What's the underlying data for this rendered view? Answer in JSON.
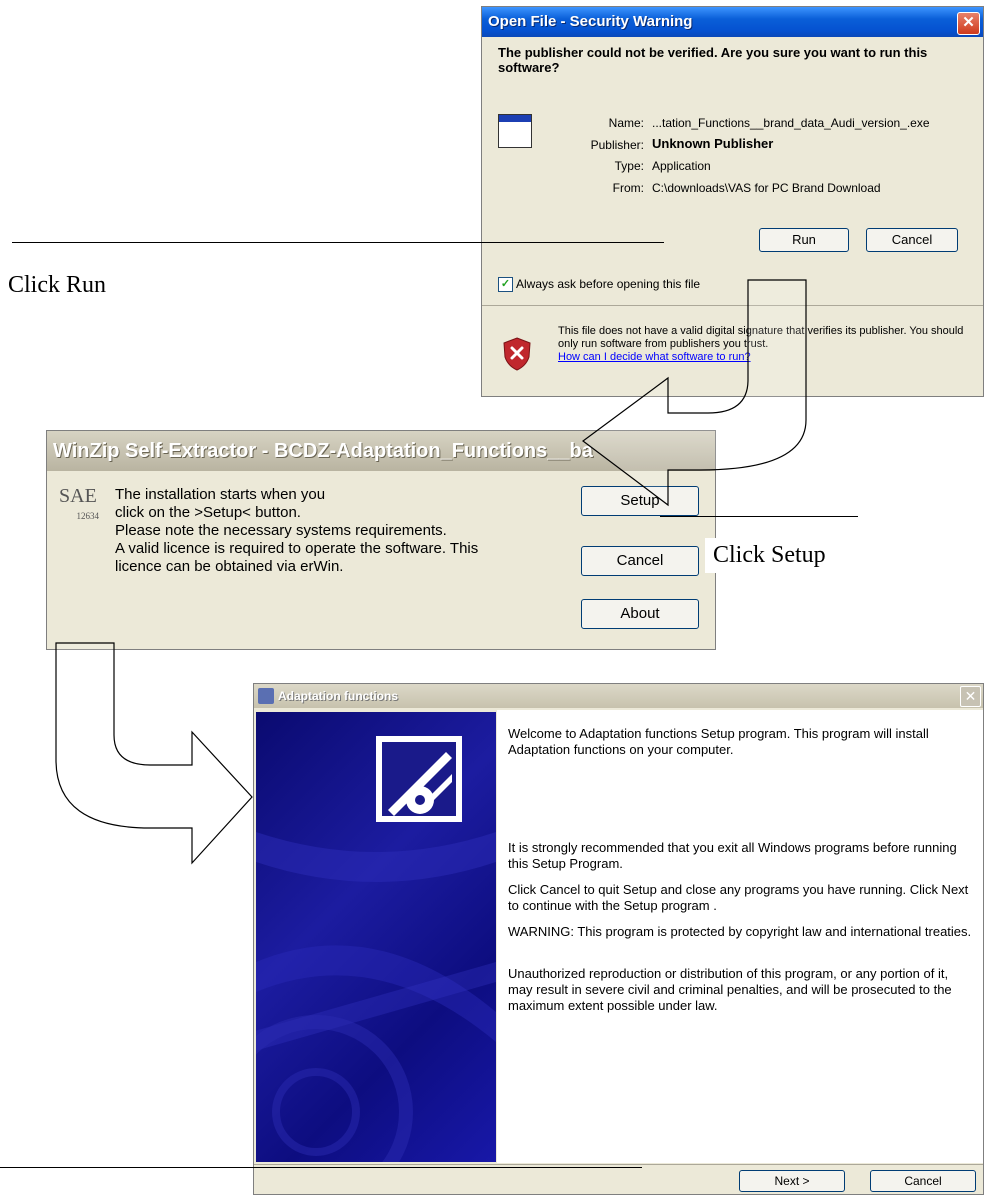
{
  "annotations": {
    "click_run": "Click Run",
    "click_setup": "Click Setup"
  },
  "security_dialog": {
    "title": "Open File - Security Warning",
    "close": "✕",
    "question": "The publisher could not be verified.  Are you sure you want to run this software?",
    "fields": [
      {
        "label": "Name:",
        "value": "...tation_Functions__brand_data_Audi_version_.exe"
      },
      {
        "label": "Publisher:",
        "value": "Unknown Publisher"
      },
      {
        "label": "Type:",
        "value": "Application"
      },
      {
        "label": "From:",
        "value": "C:\\downloads\\VAS for PC Brand Download"
      }
    ],
    "run_button": "Run",
    "cancel_button": "Cancel",
    "checkbox_checked": true,
    "checkbox_label": "Always ask before opening this file",
    "info_text": "This file does not have a valid digital signature that verifies its publisher.  You should only run software from publishers you trust.",
    "info_link": "How can I decide what software to run?",
    "icons": [
      "application-icon",
      "shield-warning-icon",
      "checkmark-icon"
    ]
  },
  "winzip_dialog": {
    "title": "WinZip Self-Extractor - BCDZ-Adaptation_Functions__ba",
    "logo_text": "SA",
    "logo_sub": "E",
    "logo_code": "12634",
    "message_lines": [
      "The installation starts when you",
      "click on the >Setup< button.",
      "Please note the necessary systems requirements.",
      "A valid licence is required to operate the software. This",
      "licence can be obtained via erWin."
    ],
    "setup_button": "Setup",
    "cancel_button": "Cancel",
    "about_button": "About"
  },
  "setup_dialog": {
    "title": "Adaptation functions",
    "close": "✕",
    "paragraphs": [
      "Welcome to Adaptation functions Setup program. This program will install Adaptation functions on your computer.",
      "It is strongly recommended that you exit all Windows programs before running this Setup Program.",
      "Click Cancel to quit Setup and close any programs you have running. Click Next to continue with the Setup program .",
      "WARNING: This program is protected by copyright law and international treaties.",
      "Unauthorized reproduction or distribution of this program, or any portion of it, may result in severe civil and criminal penalties, and will be prosecuted to the maximum extent possible under law."
    ],
    "next_button": "Next >",
    "cancel_button": "Cancel",
    "colors": {
      "art_blue": "#1818a0"
    }
  }
}
